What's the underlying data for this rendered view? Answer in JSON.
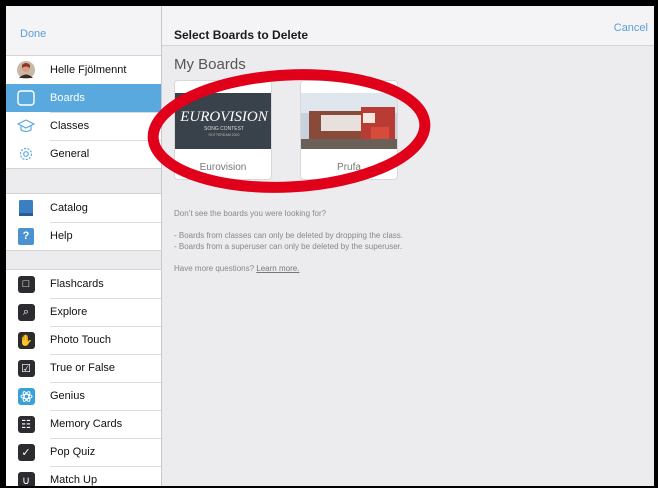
{
  "sidebar": {
    "done_label": "Done",
    "user": {
      "name": "Helle Fjölmennt"
    },
    "nav": [
      {
        "label": "Boards",
        "icon": "boards-icon",
        "active": true
      },
      {
        "label": "Classes",
        "icon": "classes-icon",
        "active": false
      },
      {
        "label": "General",
        "icon": "gear-icon",
        "active": false
      }
    ],
    "support": [
      {
        "label": "Catalog",
        "icon": "book-icon"
      },
      {
        "label": "Help",
        "icon": "question-icon"
      }
    ],
    "modes": [
      {
        "label": "Flashcards",
        "icon": "flashcards-icon"
      },
      {
        "label": "Explore",
        "icon": "explore-icon"
      },
      {
        "label": "Photo Touch",
        "icon": "hand-icon"
      },
      {
        "label": "True or False",
        "icon": "checkbox-icon"
      },
      {
        "label": "Genius",
        "icon": "atom-icon"
      },
      {
        "label": "Memory Cards",
        "icon": "grid-icon"
      },
      {
        "label": "Pop Quiz",
        "icon": "quiz-icon"
      },
      {
        "label": "Match Up",
        "icon": "magnet-icon"
      }
    ]
  },
  "main": {
    "title": "Select Boards to Delete",
    "cancel_label": "Cancel",
    "section_title": "My Boards",
    "boards": [
      {
        "name": "Eurovision",
        "logo_text": "EUROVISION",
        "logo_sub": "SONG CONTEST",
        "logo_sub2": "ROTTERDAM 2020"
      },
      {
        "name": "Prufa"
      }
    ],
    "help_question": "Don’t see the boards you were looking for?",
    "help_lines": [
      "- Boards from classes can only be deleted by dropping the class.",
      "- Boards from a superuser can only be deleted by the superuser."
    ],
    "more_prefix": "Have more questions? ",
    "more_link": "Learn more."
  },
  "colors": {
    "accent": "#5aa9de",
    "link": "#5a9fd6",
    "annotation": "#e0001a",
    "eurovision_bg": "#3a4048"
  }
}
